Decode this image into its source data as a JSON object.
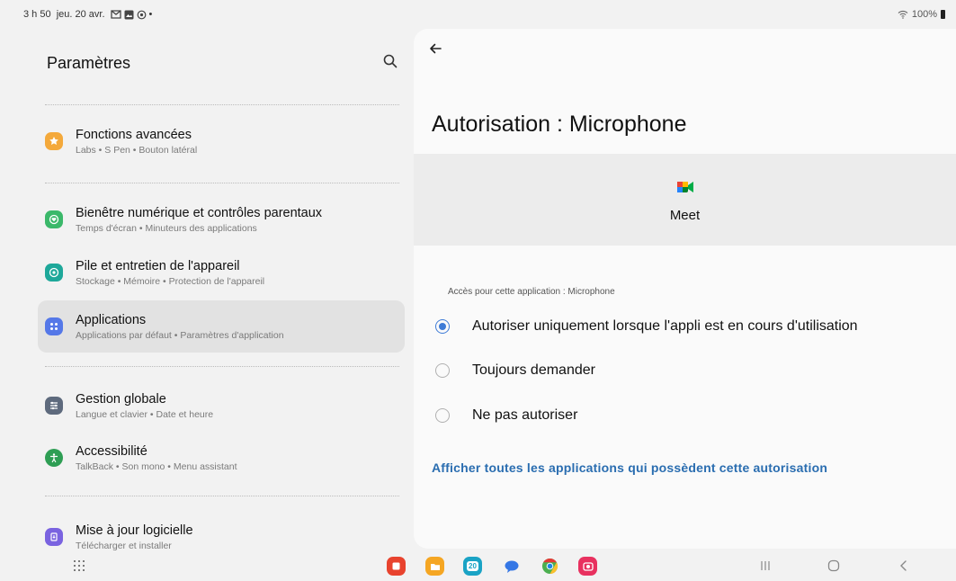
{
  "status_bar": {
    "time_date": "3 h 50  jeu. 20 avr.",
    "notification_icons": [
      "gmail-icon",
      "image-icon",
      "sync-icon",
      "dot-icon"
    ],
    "battery": "100%"
  },
  "left_panel": {
    "title": "Paramètres",
    "items": [
      {
        "title": "Fonctions avancées",
        "subtitle": "Labs  •  S Pen  •  Bouton latéral",
        "icon": "star-icon",
        "color": "#f4a93b"
      },
      {
        "title": "Bienêtre numérique et contrôles parentaux",
        "subtitle": "Temps d'écran  •  Minuteurs des applications",
        "icon": "heart-icon",
        "color": "#3bb86a"
      },
      {
        "title": "Pile et entretien de l'appareil",
        "subtitle": "Stockage  •  Mémoire  •  Protection de l'appareil",
        "icon": "battery-care-icon",
        "color": "#1ea89a"
      },
      {
        "title": "Applications",
        "subtitle": "Applications par défaut  •  Paramètres d'application",
        "icon": "apps-icon",
        "color": "#5578e8"
      },
      {
        "title": "Gestion globale",
        "subtitle": "Langue et clavier  •  Date et heure",
        "icon": "sliders-icon",
        "color": "#5e6a7d"
      },
      {
        "title": "Accessibilité",
        "subtitle": "TalkBack  •  Son mono  •  Menu assistant",
        "icon": "accessibility-icon",
        "color": "#2e9e54"
      },
      {
        "title": "Mise à jour logicielle",
        "subtitle": "Télécharger et installer",
        "icon": "update-icon",
        "color": "#7a63e0"
      }
    ]
  },
  "right_panel": {
    "title": "Autorisation : Microphone",
    "app_name": "Meet",
    "section_label": "Accès pour cette application : Microphone",
    "options": [
      {
        "label": "Autoriser uniquement lorsque l'appli est en cours d'utilisation",
        "checked": true
      },
      {
        "label": "Toujours demander",
        "checked": false
      },
      {
        "label": "Ne pas autoriser",
        "checked": false
      }
    ],
    "link": "Afficher toutes les applications qui possèdent cette autorisation"
  },
  "dock": {
    "apps": [
      {
        "name": "notes-app-icon",
        "color": "#e8432e"
      },
      {
        "name": "my-files-app-icon",
        "color": "#f5a623"
      },
      {
        "name": "calendar-app-icon",
        "color": "#1aa3c5",
        "label": "20"
      },
      {
        "name": "messages-app-icon",
        "color": "#3577e5"
      },
      {
        "name": "chrome-app-icon",
        "color": "#4caf50"
      },
      {
        "name": "camera-app-icon",
        "color": "#e8315f"
      }
    ]
  },
  "colors": {
    "accent": "#3e7bd6",
    "link": "#2a6db0",
    "active_item": "#e2e2e2"
  }
}
